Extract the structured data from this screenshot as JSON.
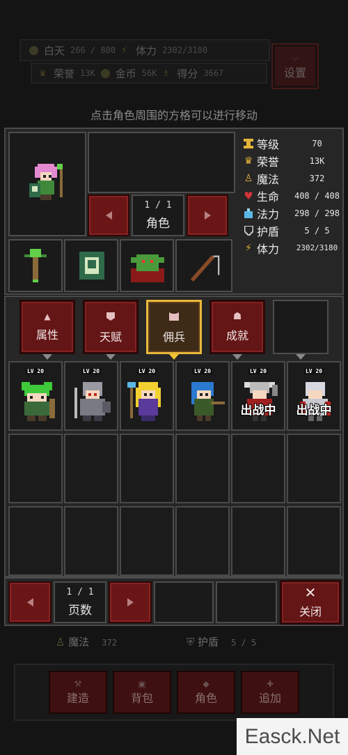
{
  "top_status": {
    "day_label": "白天",
    "day_value": "266 / 800",
    "stamina_label": "体力",
    "stamina_value": "2302/3180",
    "honor_label": "荣誉",
    "honor_value": "13K",
    "gold_label": "金币",
    "gold_value": "56K",
    "score_label": "得分",
    "score_value": "3667",
    "settings_label": "设置"
  },
  "hint": "点击角色周围的方格可以进行移动",
  "character": {
    "page_current": "1",
    "page_total": "1",
    "page_label": "角色",
    "stats": [
      {
        "icon": "level-icon",
        "label": "等级",
        "value": "70",
        "color": "#e3b43a"
      },
      {
        "icon": "honor-icon",
        "label": "荣誉",
        "value": "13K",
        "color": "#e3b43a"
      },
      {
        "icon": "magic-icon",
        "label": "魔法",
        "value": "372",
        "color": "#e3b43a"
      },
      {
        "icon": "heart-icon",
        "label": "生命",
        "value": "408 / 408",
        "color": "#d0343a"
      },
      {
        "icon": "mana-potion-icon",
        "label": "法力",
        "value": "298 / 298",
        "color": "#5ab8e6"
      },
      {
        "icon": "shield-icon",
        "label": "护盾",
        "value": "5 / 5",
        "color": "#cfcfcf"
      },
      {
        "icon": "stamina-icon",
        "label": "体力",
        "value": "2302/3180",
        "color": "#e3b43a"
      }
    ],
    "equipment": [
      "staff-icon",
      "spellbook-icon",
      "goblin-pet-icon",
      "fishing-rod-icon"
    ]
  },
  "tabs": [
    {
      "label": "属性",
      "icon": "arrow-up-icon",
      "active": false
    },
    {
      "label": "天赋",
      "icon": "badge-icon",
      "active": false
    },
    {
      "label": "佣兵",
      "icon": "mercenary-icon",
      "active": true
    },
    {
      "label": "成就",
      "icon": "trophy-icon",
      "active": false
    },
    {
      "label": "",
      "icon": "",
      "active": false
    }
  ],
  "mercenaries": [
    {
      "level": "LV 20",
      "sprite": "green-haired-ranger",
      "status": ""
    },
    {
      "level": "LV 20",
      "sprite": "armored-knight",
      "status": ""
    },
    {
      "level": "LV 20",
      "sprite": "blonde-mage",
      "status": ""
    },
    {
      "level": "LV 20",
      "sprite": "blue-haired-archer",
      "status": ""
    },
    {
      "level": "LV 20",
      "sprite": "horned-warrior",
      "status": "出战中"
    },
    {
      "level": "LV 20",
      "sprite": "silver-paladin",
      "status": "出战中"
    }
  ],
  "pager": {
    "page_current": "1",
    "page_total": "1",
    "page_label": "页数",
    "close_label": "关闭"
  },
  "background": {
    "magic_label": "魔法",
    "magic_value": "372",
    "shield_label": "护盾",
    "shield_value": "5 / 5",
    "buttons": [
      "建造",
      "背包",
      "角色",
      "追加"
    ]
  },
  "watermark": "Easck.Net"
}
